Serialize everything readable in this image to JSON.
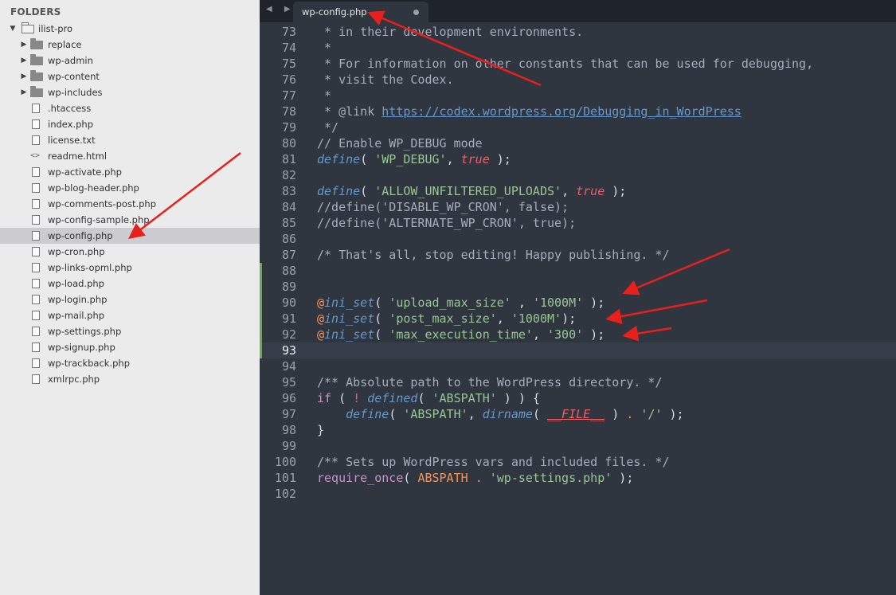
{
  "sidebar": {
    "title": "FOLDERS",
    "items": [
      {
        "label": "ilist-pro",
        "kind": "folder-open",
        "depth": 0,
        "arrow": "▼",
        "selected": false
      },
      {
        "label": "replace",
        "kind": "folder",
        "depth": 1,
        "arrow": "▶",
        "selected": false
      },
      {
        "label": "wp-admin",
        "kind": "folder",
        "depth": 1,
        "arrow": "▶",
        "selected": false
      },
      {
        "label": "wp-content",
        "kind": "folder",
        "depth": 1,
        "arrow": "▶",
        "selected": false
      },
      {
        "label": "wp-includes",
        "kind": "folder",
        "depth": 1,
        "arrow": "▶",
        "selected": false
      },
      {
        "label": ".htaccess",
        "kind": "file",
        "depth": 1,
        "selected": false
      },
      {
        "label": "index.php",
        "kind": "file",
        "depth": 1,
        "selected": false
      },
      {
        "label": "license.txt",
        "kind": "file",
        "depth": 1,
        "selected": false
      },
      {
        "label": "readme.html",
        "kind": "code",
        "depth": 1,
        "selected": false
      },
      {
        "label": "wp-activate.php",
        "kind": "file",
        "depth": 1,
        "selected": false
      },
      {
        "label": "wp-blog-header.php",
        "kind": "file",
        "depth": 1,
        "selected": false
      },
      {
        "label": "wp-comments-post.php",
        "kind": "file",
        "depth": 1,
        "selected": false
      },
      {
        "label": "wp-config-sample.php",
        "kind": "file",
        "depth": 1,
        "selected": false
      },
      {
        "label": "wp-config.php",
        "kind": "file",
        "depth": 1,
        "selected": true
      },
      {
        "label": "wp-cron.php",
        "kind": "file",
        "depth": 1,
        "selected": false
      },
      {
        "label": "wp-links-opml.php",
        "kind": "file",
        "depth": 1,
        "selected": false
      },
      {
        "label": "wp-load.php",
        "kind": "file",
        "depth": 1,
        "selected": false
      },
      {
        "label": "wp-login.php",
        "kind": "file",
        "depth": 1,
        "selected": false
      },
      {
        "label": "wp-mail.php",
        "kind": "file",
        "depth": 1,
        "selected": false
      },
      {
        "label": "wp-settings.php",
        "kind": "file",
        "depth": 1,
        "selected": false
      },
      {
        "label": "wp-signup.php",
        "kind": "file",
        "depth": 1,
        "selected": false
      },
      {
        "label": "wp-trackback.php",
        "kind": "file",
        "depth": 1,
        "selected": false
      },
      {
        "label": "xmlrpc.php",
        "kind": "file",
        "depth": 1,
        "selected": false
      }
    ]
  },
  "tabbar": {
    "nav": "◀ ▶",
    "tabs": [
      {
        "label": "wp-config.php",
        "modified": true
      }
    ]
  },
  "editor": {
    "current_line": 93,
    "lines": [
      {
        "n": 73,
        "tokens": [
          [
            "c",
            " * in their development environments."
          ]
        ]
      },
      {
        "n": 74,
        "tokens": [
          [
            "c",
            " *"
          ]
        ]
      },
      {
        "n": 75,
        "tokens": [
          [
            "c",
            " * For information on other constants that can be used for debugging,"
          ]
        ]
      },
      {
        "n": 76,
        "tokens": [
          [
            "c",
            " * visit the Codex."
          ]
        ]
      },
      {
        "n": 77,
        "tokens": [
          [
            "c",
            " *"
          ]
        ]
      },
      {
        "n": 78,
        "tokens": [
          [
            "c",
            " * @link "
          ],
          [
            "u",
            "https://codex.wordpress.org/Debugging_in_WordPress"
          ]
        ]
      },
      {
        "n": 79,
        "tokens": [
          [
            "c",
            " */"
          ]
        ]
      },
      {
        "n": 80,
        "tokens": [
          [
            "c",
            "// Enable WP_DEBUG mode"
          ]
        ]
      },
      {
        "n": 81,
        "tokens": [
          [
            "k",
            "define"
          ],
          [
            "p",
            "( "
          ],
          [
            "s",
            "'WP_DEBUG'"
          ],
          [
            "p",
            ", "
          ],
          [
            "b",
            "true"
          ],
          [
            "p",
            " );"
          ]
        ]
      },
      {
        "n": 82,
        "tokens": []
      },
      {
        "n": 83,
        "tokens": [
          [
            "k",
            "define"
          ],
          [
            "p",
            "( "
          ],
          [
            "s",
            "'ALLOW_UNFILTERED_UPLOADS'"
          ],
          [
            "p",
            ", "
          ],
          [
            "b",
            "true"
          ],
          [
            "p",
            " );"
          ]
        ]
      },
      {
        "n": 84,
        "tokens": [
          [
            "c",
            "//define('DISABLE_WP_CRON', false);"
          ]
        ]
      },
      {
        "n": 85,
        "tokens": [
          [
            "c",
            "//define('ALTERNATE_WP_CRON', true);"
          ]
        ]
      },
      {
        "n": 86,
        "tokens": []
      },
      {
        "n": 87,
        "tokens": [
          [
            "c",
            "/* That's all, stop editing! Happy publishing. */"
          ]
        ]
      },
      {
        "n": 88,
        "tokens": [],
        "mark": true
      },
      {
        "n": 89,
        "tokens": [],
        "mark": true
      },
      {
        "n": 90,
        "tokens": [
          [
            "o",
            "@"
          ],
          [
            "k",
            "ini_set"
          ],
          [
            "p",
            "( "
          ],
          [
            "s",
            "'upload_max_size'"
          ],
          [
            "p",
            " , "
          ],
          [
            "s",
            "'1000M'"
          ],
          [
            "p",
            " );"
          ]
        ],
        "mark": true
      },
      {
        "n": 91,
        "tokens": [
          [
            "o",
            "@"
          ],
          [
            "k",
            "ini_set"
          ],
          [
            "p",
            "( "
          ],
          [
            "s",
            "'post_max_size'"
          ],
          [
            "p",
            ", "
          ],
          [
            "s",
            "'1000M'"
          ],
          [
            "p",
            ");"
          ]
        ],
        "mark": true
      },
      {
        "n": 92,
        "tokens": [
          [
            "o",
            "@"
          ],
          [
            "k",
            "ini_set"
          ],
          [
            "p",
            "( "
          ],
          [
            "s",
            "'max_execution_time'"
          ],
          [
            "p",
            ", "
          ],
          [
            "s",
            "'300'"
          ],
          [
            "p",
            " );"
          ]
        ],
        "mark": true
      },
      {
        "n": 93,
        "tokens": [],
        "mark": true
      },
      {
        "n": 94,
        "tokens": []
      },
      {
        "n": 95,
        "tokens": [
          [
            "c",
            "/** Absolute path to the WordPress directory. */"
          ]
        ]
      },
      {
        "n": 96,
        "tokens": [
          [
            "k2",
            "if"
          ],
          [
            "p",
            " ( "
          ],
          [
            "b2",
            "!"
          ],
          [
            "p",
            " "
          ],
          [
            "k",
            "defined"
          ],
          [
            "p",
            "( "
          ],
          [
            "s",
            "'ABSPATH'"
          ],
          [
            "p",
            " ) ) {"
          ]
        ]
      },
      {
        "n": 97,
        "tokens": [
          [
            "p",
            "    "
          ],
          [
            "k",
            "define"
          ],
          [
            "p",
            "( "
          ],
          [
            "s",
            "'ABSPATH'"
          ],
          [
            "p",
            ", "
          ],
          [
            "k",
            "dirname"
          ],
          [
            "p",
            "( "
          ],
          [
            "bu",
            "__FILE__"
          ],
          [
            "p",
            " ) "
          ],
          [
            "o",
            "."
          ],
          [
            "p",
            " "
          ],
          [
            "s",
            "'/'"
          ],
          [
            "p",
            " );"
          ]
        ]
      },
      {
        "n": 98,
        "tokens": [
          [
            "p",
            "}"
          ]
        ]
      },
      {
        "n": 99,
        "tokens": []
      },
      {
        "n": 100,
        "tokens": [
          [
            "c",
            "/** Sets up WordPress vars and included files. */"
          ]
        ]
      },
      {
        "n": 101,
        "tokens": [
          [
            "k2",
            "require_once"
          ],
          [
            "p",
            "( "
          ],
          [
            "o2",
            "ABSPATH"
          ],
          [
            "p",
            " "
          ],
          [
            "o",
            "."
          ],
          [
            "p",
            " "
          ],
          [
            "s",
            "'wp-settings.php'"
          ],
          [
            "p",
            " );"
          ]
        ]
      },
      {
        "n": 102,
        "tokens": []
      }
    ]
  },
  "annotation_color": "#e8201c",
  "icons": {
    "folder": "folder-icon",
    "file": "file-icon",
    "code": "code-file-icon",
    "expand": "chevron-right-icon",
    "collapse": "chevron-down-icon"
  }
}
